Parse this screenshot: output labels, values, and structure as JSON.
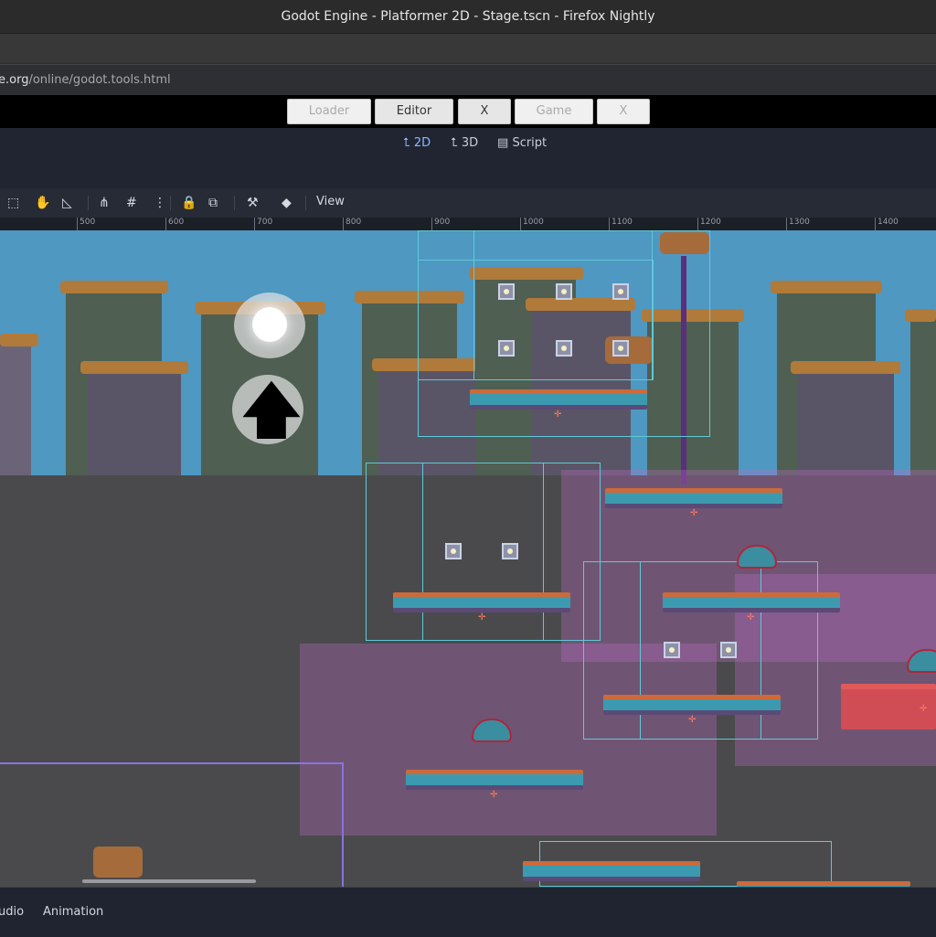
{
  "window": {
    "title": "Godot Engine - Platformer 2D - Stage.tscn - Firefox Nightly"
  },
  "urlbar": {
    "url_visible_domain": "e.org",
    "url_path": "/online/godot.tools.html"
  },
  "launcher": {
    "buttons": [
      {
        "label": "Loader",
        "state": "disabled"
      },
      {
        "label": "Editor",
        "state": "normal"
      },
      {
        "label": "X",
        "state": "normal"
      },
      {
        "label": "Game",
        "state": "disabled"
      },
      {
        "label": "X",
        "state": "disabled"
      }
    ]
  },
  "modes": [
    {
      "label": "2D",
      "icon": "2d-mode-icon",
      "active": true
    },
    {
      "label": "3D",
      "icon": "3d-mode-icon",
      "active": false
    },
    {
      "label": "Script",
      "icon": "script-icon",
      "active": false
    }
  ],
  "toolbar": {
    "view_label": "View",
    "icons": [
      "select-icon",
      "pan-hand-icon",
      "ruler-icon",
      "snap-icon",
      "grid-snap-icon",
      "more-vertical-icon",
      "lock-icon",
      "group-icon",
      "bone-icon",
      "camera-icon"
    ]
  },
  "ruler": {
    "labels": [
      "500",
      "600",
      "700",
      "800",
      "900",
      "1000",
      "1100",
      "1200",
      "1300",
      "1400"
    ]
  },
  "touch_controls": {
    "jump_symbol": "🡅"
  },
  "bottom_panel": {
    "tabs": [
      "udio",
      "Animation"
    ]
  },
  "colors": {
    "sky": "#4e98c2",
    "viewport": "#4a4a4c",
    "area_overlay": "#be6ec8",
    "collision_outline": "#5fc9d8",
    "camera_limit": "#8a72e0",
    "editor_bg": "#202531",
    "active_mode": "#8eb8ff"
  }
}
